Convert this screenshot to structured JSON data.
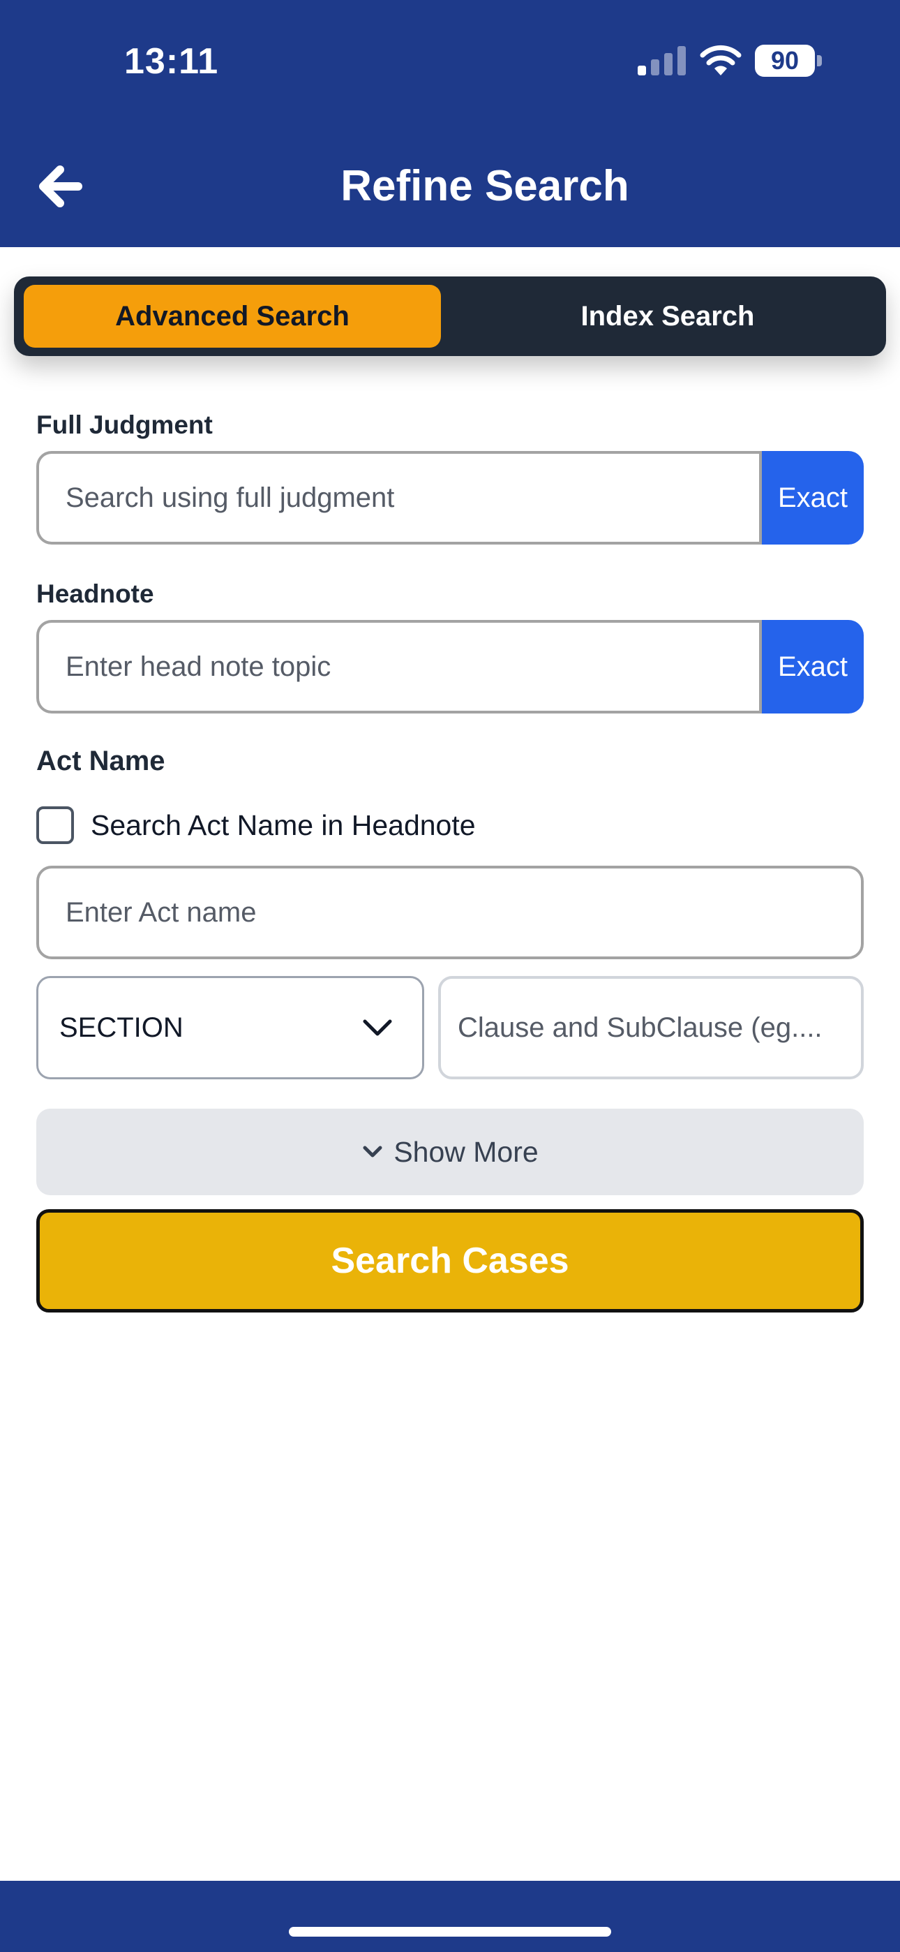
{
  "status_bar": {
    "time": "13:11",
    "battery": "90"
  },
  "header": {
    "title": "Refine Search",
    "back_icon": "arrow-left-icon"
  },
  "tabs": [
    {
      "label": "Advanced Search",
      "active": true
    },
    {
      "label": "Index Search",
      "active": false
    }
  ],
  "full_judgment": {
    "label": "Full Judgment",
    "placeholder": "Search using full judgment",
    "exact_label": "Exact"
  },
  "headnote": {
    "label": "Headnote",
    "placeholder": "Enter head note topic",
    "exact_label": "Exact"
  },
  "act": {
    "title": "Act Name",
    "checkbox_label": "Search Act Name in Headnote",
    "checkbox_checked": false,
    "placeholder": "Enter Act name",
    "section_value": "SECTION",
    "clause_placeholder": "Clause and SubClause (eg...."
  },
  "show_more": {
    "label": "Show More"
  },
  "search_button": {
    "label": "Search Cases"
  },
  "colors": {
    "primary": "#1e3a8a",
    "tab_active": "#f59e0b",
    "exact": "#2563eb",
    "search": "#eab308"
  }
}
